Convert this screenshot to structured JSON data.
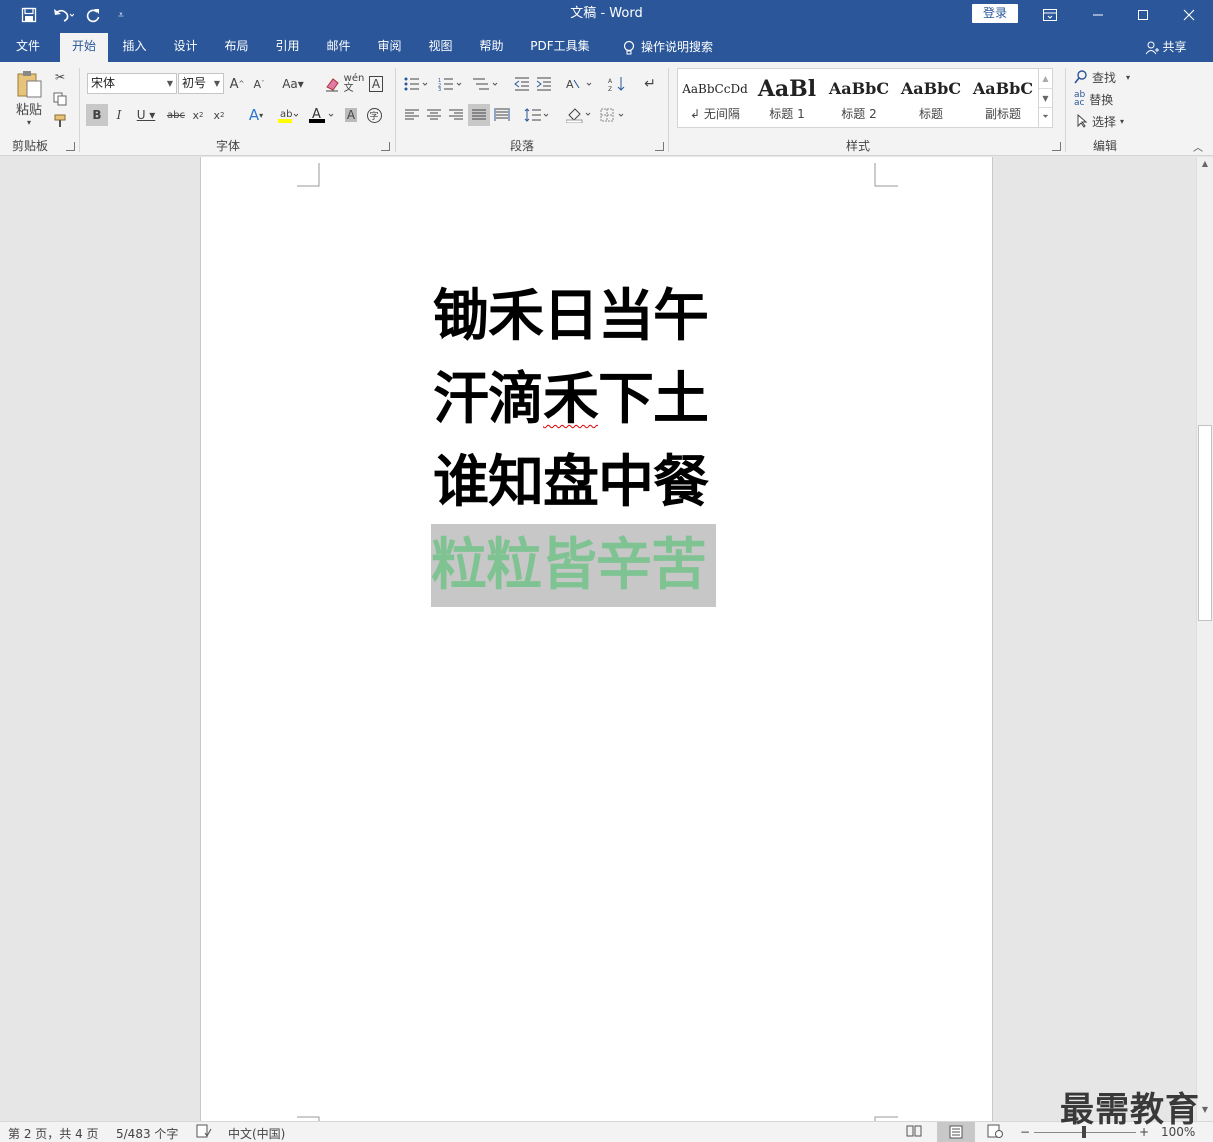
{
  "titlebar": {
    "doc_name": "文稿",
    "separator": "-",
    "app_name": "Word",
    "login_label": "登录"
  },
  "tabs": [
    {
      "label": "文件",
      "active": false
    },
    {
      "label": "开始",
      "active": true
    },
    {
      "label": "插入",
      "active": false
    },
    {
      "label": "设计",
      "active": false
    },
    {
      "label": "布局",
      "active": false
    },
    {
      "label": "引用",
      "active": false
    },
    {
      "label": "邮件",
      "active": false
    },
    {
      "label": "审阅",
      "active": false
    },
    {
      "label": "视图",
      "active": false
    },
    {
      "label": "帮助",
      "active": false
    },
    {
      "label": "PDF工具集",
      "active": false
    }
  ],
  "tell_me": "操作说明搜索",
  "share_label": "共享",
  "ribbon": {
    "clipboard": {
      "paste_label": "粘贴",
      "group_label": "剪贴板"
    },
    "font": {
      "font_name": "宋体",
      "font_size": "初号",
      "group_label": "字体"
    },
    "paragraph": {
      "group_label": "段落"
    },
    "styles": {
      "group_label": "样式",
      "items": [
        {
          "preview": "AaBbCcDd",
          "name": "无间隔"
        },
        {
          "preview": "AaBl",
          "name": "标题 1"
        },
        {
          "preview": "AaBbC",
          "name": "标题 2"
        },
        {
          "preview": "AaBbC",
          "name": "标题"
        },
        {
          "preview": "AaBbC",
          "name": "副标题"
        }
      ]
    },
    "editing": {
      "find": "查找",
      "replace": "替换",
      "select": "选择",
      "group_label": "编辑"
    }
  },
  "document": {
    "lines": [
      "锄禾日当午",
      "汗滴禾下土",
      "谁知盘中餐"
    ],
    "selected_line": "粒粒皆辛苦",
    "line2_prefix": "汗滴",
    "line2_error": "禾",
    "line2_suffix": "下土"
  },
  "status": {
    "page": "第 2 页，共 4 页",
    "words": "5/483 个字",
    "language": "中文(中国)",
    "zoom": "100%"
  },
  "watermark": "最需教育",
  "colors": {
    "accent": "#2b579a",
    "selected_text": "#7fc393",
    "selection_bg": "#c7c7c7"
  }
}
